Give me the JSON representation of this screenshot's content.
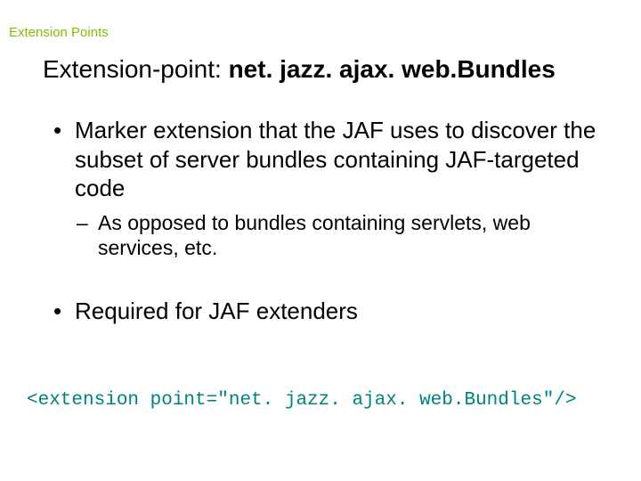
{
  "section_label": "Extension Points",
  "title_plain": "Extension-point: ",
  "title_bold": "net. jazz. ajax. web.Bundles",
  "bullets": {
    "b1": "Marker extension that the JAF uses to discover the subset of server bundles containing JAF-targeted code",
    "b1_sub1": "As opposed to bundles containing servlets, web services, etc.",
    "b2": "Required for JAF extenders"
  },
  "code_line": "<extension point=\"net. jazz. ajax. web.Bundles\"/>"
}
